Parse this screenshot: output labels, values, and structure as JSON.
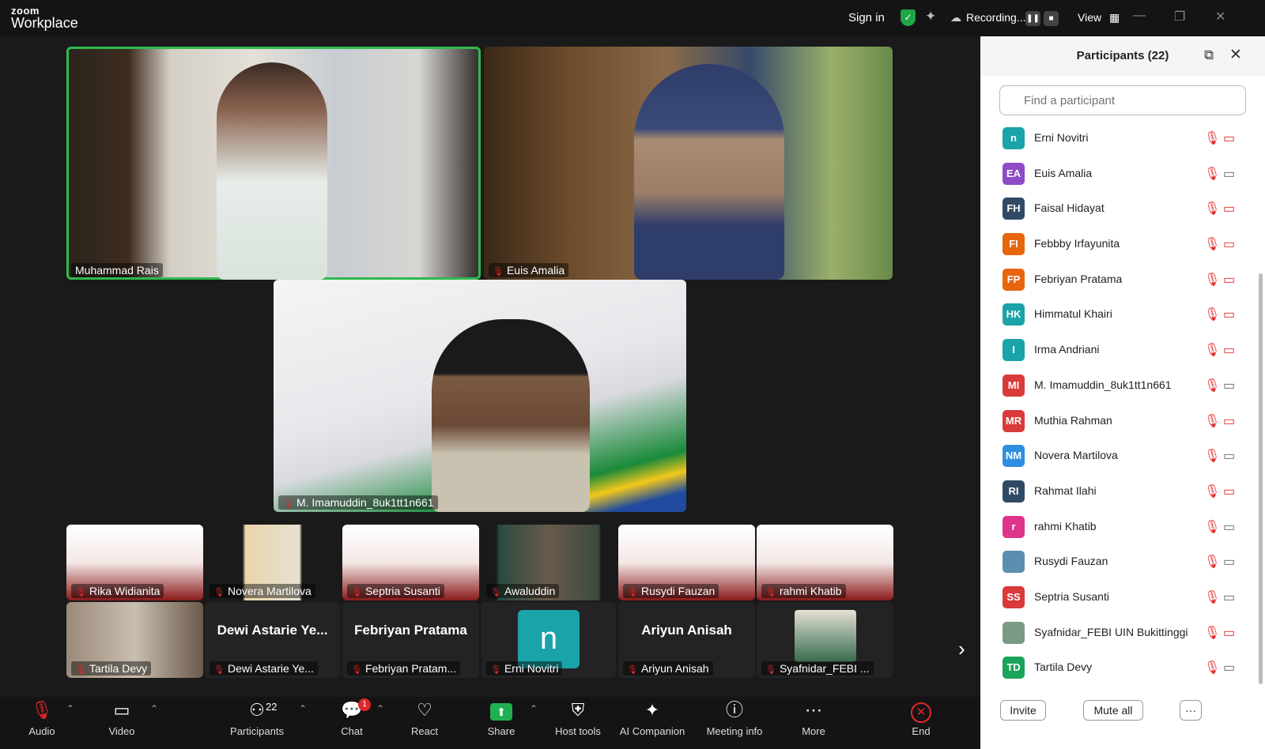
{
  "app": {
    "brand_small": "zoom",
    "brand_big": "Workplace"
  },
  "topbar": {
    "sign_in": "Sign in",
    "recording_label": "Recording...",
    "view_label": "View"
  },
  "tiles": {
    "main_left": "Muhammad Rais",
    "main_right": "Euis Amalia",
    "main_center": "M. Imamuddin_8uk1tt1n661",
    "gallery": [
      {
        "label": "Rika Widianita",
        "big": ""
      },
      {
        "label": "Novera Martilova",
        "big": ""
      },
      {
        "label": "Septria Susanti",
        "big": ""
      },
      {
        "label": "Awaluddin",
        "big": ""
      },
      {
        "label": "Rusydi Fauzan",
        "big": ""
      },
      {
        "label": "rahmi Khatib",
        "big": ""
      },
      {
        "label": "Tartila Devy",
        "big": ""
      },
      {
        "label": "Dewi Astarie Ye...",
        "big": "Dewi Astarie Ye..."
      },
      {
        "label": "Febriyan Pratam...",
        "big": "Febriyan Pratama"
      },
      {
        "label": "Erni Novitri",
        "big": ""
      },
      {
        "label": "Ariyun Anisah",
        "big": "Ariyun Anisah"
      },
      {
        "label": "Syafnidar_FEBI ...",
        "big": ""
      }
    ],
    "erni_initial": "n"
  },
  "toolbar": {
    "audio": "Audio",
    "video": "Video",
    "participants": "Participants",
    "participants_count": "22",
    "chat": "Chat",
    "chat_badge": "1",
    "react": "React",
    "share": "Share",
    "host_tools": "Host tools",
    "ai_companion": "AI Companion",
    "meeting_info": "Meeting info",
    "more": "More",
    "end": "End"
  },
  "panel": {
    "title": "Participants (22)",
    "search_placeholder": "Find a participant",
    "invite": "Invite",
    "mute_all": "Mute all",
    "more": "···",
    "participants": [
      {
        "initials": "n",
        "name": "Erni Novitri",
        "color": "#1aa3a8",
        "cam_on": false
      },
      {
        "initials": "EA",
        "name": "Euis Amalia",
        "color": "#8e4bc5",
        "cam_on": true
      },
      {
        "initials": "FH",
        "name": "Faisal Hidayat",
        "color": "#2f4a66",
        "cam_on": false
      },
      {
        "initials": "FI",
        "name": "Febbby Irfayunita",
        "color": "#e8650f",
        "cam_on": false
      },
      {
        "initials": "FP",
        "name": "Febriyan Pratama",
        "color": "#e8650f",
        "cam_on": false
      },
      {
        "initials": "HK",
        "name": "Himmatul Khairi",
        "color": "#1aa3a8",
        "cam_on": false
      },
      {
        "initials": "I",
        "name": "Irma Andriani",
        "color": "#1aa3a8",
        "cam_on": false
      },
      {
        "initials": "MI",
        "name": "M. Imamuddin_8uk1tt1n661",
        "color": "#d93a3a",
        "cam_on": true
      },
      {
        "initials": "MR",
        "name": "Muthia Rahman",
        "color": "#d93a3a",
        "cam_on": false
      },
      {
        "initials": "NM",
        "name": "Novera Martilova",
        "color": "#2e8fe0",
        "cam_on": true
      },
      {
        "initials": "RI",
        "name": "Rahmat Ilahi",
        "color": "#2f4a66",
        "cam_on": false
      },
      {
        "initials": "r",
        "name": "rahmi Khatib",
        "color": "#e0338c",
        "cam_on": true
      },
      {
        "initials": "",
        "name": "Rusydi Fauzan",
        "color": "#5a8fb0",
        "cam_on": true
      },
      {
        "initials": "SS",
        "name": "Septria Susanti",
        "color": "#d93a3a",
        "cam_on": true
      },
      {
        "initials": "",
        "name": "Syafnidar_FEBI UIN Bukittinggi",
        "color": "#7a9a86",
        "cam_on": false
      },
      {
        "initials": "TD",
        "name": "Tartila Devy",
        "color": "#1aa35a",
        "cam_on": true
      }
    ]
  }
}
